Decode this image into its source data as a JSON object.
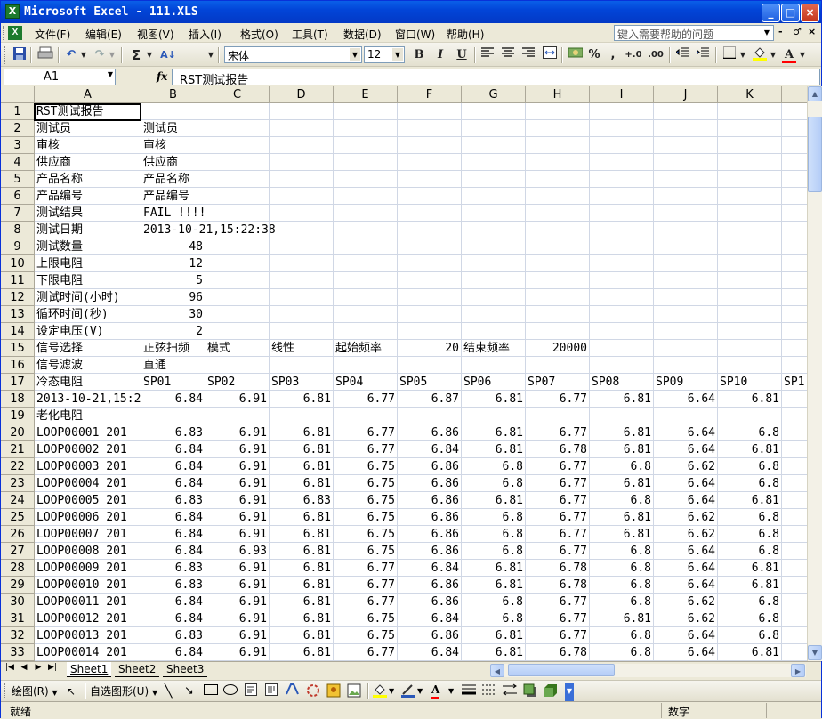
{
  "window": {
    "title": "Microsoft Excel - 111.XLS",
    "app_icon": "excel-icon",
    "controls": {
      "minimize": "_",
      "maximize": "□",
      "close": "×"
    }
  },
  "menu": {
    "items": [
      "文件(F)",
      "编辑(E)",
      "视图(V)",
      "插入(I)",
      "格式(O)",
      "工具(T)",
      "数据(D)",
      "窗口(W)",
      "帮助(H)"
    ],
    "help_placeholder": "键入需要帮助的问题",
    "doc_controls": [
      "-",
      "♂",
      "×"
    ]
  },
  "toolbar": {
    "font_name": "宋体",
    "font_size": "12",
    "bold": "B",
    "italic": "I",
    "underline": "U",
    "sigma": "Σ",
    "percent": "%",
    "comma": ",",
    "font_color_letter": "A",
    "fill_color": "#ffff00",
    "font_color": "#ff0000"
  },
  "formula_bar": {
    "name_box": "A1",
    "fx": "fx",
    "content": "RST测试报告"
  },
  "columns": [
    "A",
    "B",
    "C",
    "D",
    "E",
    "F",
    "G",
    "H",
    "I",
    "J",
    "K"
  ],
  "rows": [
    {
      "n": "1",
      "cells": [
        "RST测试报告"
      ]
    },
    {
      "n": "2",
      "cells": [
        "测试员",
        "测试员"
      ]
    },
    {
      "n": "3",
      "cells": [
        "审核",
        "审核"
      ]
    },
    {
      "n": "4",
      "cells": [
        "供应商",
        "供应商"
      ]
    },
    {
      "n": "5",
      "cells": [
        "产品名称",
        "产品名称"
      ]
    },
    {
      "n": "6",
      "cells": [
        "产品编号",
        "产品编号"
      ]
    },
    {
      "n": "7",
      "cells": [
        "测试结果",
        "FAIL  !!!!"
      ]
    },
    {
      "n": "8",
      "cells": [
        "测试日期",
        "2013-10-21,15:22:38"
      ]
    },
    {
      "n": "9",
      "cells": [
        "测试数量",
        "48"
      ]
    },
    {
      "n": "10",
      "cells": [
        "上限电阻",
        "12"
      ]
    },
    {
      "n": "11",
      "cells": [
        "下限电阻",
        "5"
      ]
    },
    {
      "n": "12",
      "cells": [
        "测试时间(小时)",
        "96"
      ]
    },
    {
      "n": "13",
      "cells": [
        "循环时间(秒)",
        "30"
      ]
    },
    {
      "n": "14",
      "cells": [
        "设定电压(V)",
        "2"
      ]
    },
    {
      "n": "15",
      "cells": [
        "信号选择",
        "正弦扫频",
        "模式",
        "线性",
        "起始频率",
        "20",
        "结束频率",
        "20000"
      ]
    },
    {
      "n": "16",
      "cells": [
        "信号滤波",
        "直通"
      ]
    },
    {
      "n": "17",
      "cells": [
        "冷态电阻",
        "SP01",
        "SP02",
        "SP03",
        "SP04",
        "SP05",
        "SP06",
        "SP07",
        "SP08",
        "SP09",
        "SP10",
        "SP1"
      ]
    },
    {
      "n": "18",
      "cells": [
        "2013-10-21,15:2",
        "6.84",
        "6.91",
        "6.81",
        "6.77",
        "6.87",
        "6.81",
        "6.77",
        "6.81",
        "6.64",
        "6.81"
      ]
    },
    {
      "n": "19",
      "cells": [
        "老化电阻"
      ]
    },
    {
      "n": "20",
      "cells": [
        "LOOP00001    201",
        "6.83",
        "6.91",
        "6.81",
        "6.77",
        "6.86",
        "6.81",
        "6.77",
        "6.81",
        "6.64",
        "6.8"
      ]
    },
    {
      "n": "21",
      "cells": [
        "LOOP00002    201",
        "6.84",
        "6.91",
        "6.81",
        "6.77",
        "6.84",
        "6.81",
        "6.78",
        "6.81",
        "6.64",
        "6.81"
      ]
    },
    {
      "n": "22",
      "cells": [
        "LOOP00003    201",
        "6.84",
        "6.91",
        "6.81",
        "6.75",
        "6.86",
        "6.8",
        "6.77",
        "6.8",
        "6.62",
        "6.8"
      ]
    },
    {
      "n": "23",
      "cells": [
        "LOOP00004    201",
        "6.84",
        "6.91",
        "6.81",
        "6.75",
        "6.86",
        "6.8",
        "6.77",
        "6.81",
        "6.64",
        "6.8"
      ]
    },
    {
      "n": "24",
      "cells": [
        "LOOP00005    201",
        "6.83",
        "6.91",
        "6.83",
        "6.75",
        "6.86",
        "6.81",
        "6.77",
        "6.8",
        "6.64",
        "6.81"
      ]
    },
    {
      "n": "25",
      "cells": [
        "LOOP00006    201",
        "6.84",
        "6.91",
        "6.81",
        "6.75",
        "6.86",
        "6.8",
        "6.77",
        "6.81",
        "6.62",
        "6.8"
      ]
    },
    {
      "n": "26",
      "cells": [
        "LOOP00007    201",
        "6.84",
        "6.91",
        "6.81",
        "6.75",
        "6.86",
        "6.8",
        "6.77",
        "6.81",
        "6.62",
        "6.8"
      ]
    },
    {
      "n": "27",
      "cells": [
        "LOOP00008    201",
        "6.84",
        "6.93",
        "6.81",
        "6.75",
        "6.86",
        "6.8",
        "6.77",
        "6.8",
        "6.64",
        "6.8"
      ]
    },
    {
      "n": "28",
      "cells": [
        "LOOP00009    201",
        "6.83",
        "6.91",
        "6.81",
        "6.77",
        "6.84",
        "6.81",
        "6.78",
        "6.8",
        "6.64",
        "6.81"
      ]
    },
    {
      "n": "29",
      "cells": [
        "LOOP00010    201",
        "6.83",
        "6.91",
        "6.81",
        "6.77",
        "6.86",
        "6.81",
        "6.78",
        "6.8",
        "6.64",
        "6.81"
      ]
    },
    {
      "n": "30",
      "cells": [
        "LOOP00011    201",
        "6.84",
        "6.91",
        "6.81",
        "6.77",
        "6.86",
        "6.8",
        "6.77",
        "6.8",
        "6.62",
        "6.8"
      ]
    },
    {
      "n": "31",
      "cells": [
        "LOOP00012    201",
        "6.84",
        "6.91",
        "6.81",
        "6.75",
        "6.84",
        "6.8",
        "6.77",
        "6.81",
        "6.62",
        "6.8"
      ]
    },
    {
      "n": "32",
      "cells": [
        "LOOP00013    201",
        "6.83",
        "6.91",
        "6.81",
        "6.75",
        "6.86",
        "6.81",
        "6.77",
        "6.8",
        "6.64",
        "6.8"
      ]
    },
    {
      "n": "33",
      "cells": [
        "LOOP00014    201",
        "6.84",
        "6.91",
        "6.81",
        "6.77",
        "6.84",
        "6.81",
        "6.78",
        "6.8",
        "6.64",
        "6.81"
      ]
    }
  ],
  "sheets": [
    "Sheet1",
    "Sheet2",
    "Sheet3"
  ],
  "active_sheet": "Sheet1",
  "drawing_toolbar": {
    "draw": "绘图(R)",
    "autoshapes": "自选图形(U)"
  },
  "status": {
    "left": "就绪",
    "right": "数字"
  }
}
